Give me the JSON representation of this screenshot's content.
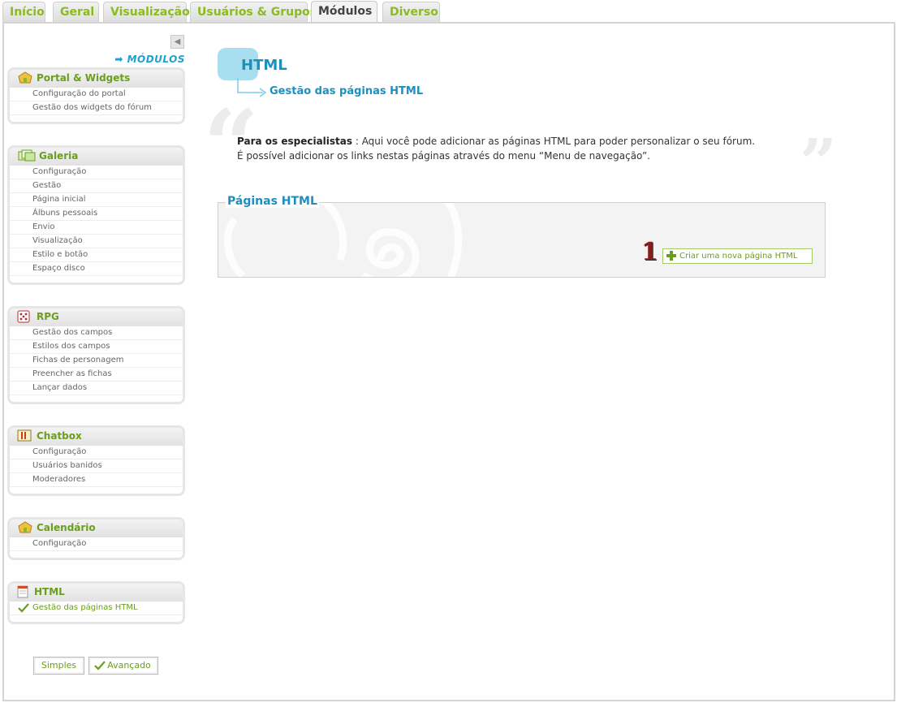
{
  "tabs": [
    {
      "label": "Início",
      "active": false
    },
    {
      "label": "Geral",
      "active": false
    },
    {
      "label": "Visualização",
      "active": false
    },
    {
      "label": "Usuários & Grupos",
      "active": false
    },
    {
      "label": "Módulos",
      "active": true
    },
    {
      "label": "Diverso",
      "active": false
    }
  ],
  "sidebar": {
    "collapse_icon": "triangle-left-icon",
    "title": "➡ MÓDULOS",
    "sections": [
      {
        "title": "Portal & Widgets",
        "icon": "portal-icon",
        "items": [
          "Configuração do portal",
          "Gestão dos widgets do fórum"
        ]
      },
      {
        "title": "Galeria",
        "icon": "gallery-icon",
        "items": [
          "Configuração",
          "Gestão",
          "Página inicial",
          "Álbuns pessoais",
          "Envio",
          "Visualização",
          "Estilo e botão",
          "Espaço disco"
        ]
      },
      {
        "title": "RPG",
        "icon": "dice-icon",
        "items": [
          "Gestão dos campos",
          "Estilos dos campos",
          "Fichas de personagem",
          "Preencher as fichas",
          "Lançar dados"
        ]
      },
      {
        "title": "Chatbox",
        "icon": "chatbox-icon",
        "items": [
          "Configuração",
          "Usuários banidos",
          "Moderadores"
        ]
      },
      {
        "title": "Calendário",
        "icon": "calendar-icon",
        "items": [
          "Configuração"
        ]
      },
      {
        "title": "HTML",
        "icon": "html-page-icon",
        "items": [
          "Gestão das páginas HTML"
        ]
      }
    ],
    "mode_buttons": {
      "simple": "Simples",
      "advanced": "Avançado"
    }
  },
  "main": {
    "title": "HTML",
    "subtitle": "Gestão das páginas HTML",
    "intro": {
      "strong": "Para os especialistas",
      "line1_rest": " : Aqui você pode adicionar as páginas HTML para poder personalizar o seu fórum.",
      "line2": "É possível adicionar os links nestas páginas através do menu “Menu de navegação”."
    },
    "fieldset_legend": "Páginas HTML",
    "step_number": "1",
    "create_button": "Criar uma nova página HTML"
  },
  "colors": {
    "accent_green": "#6a9e1c",
    "accent_blue": "#1d8fbf",
    "tab_green": "#8bbb1f"
  }
}
